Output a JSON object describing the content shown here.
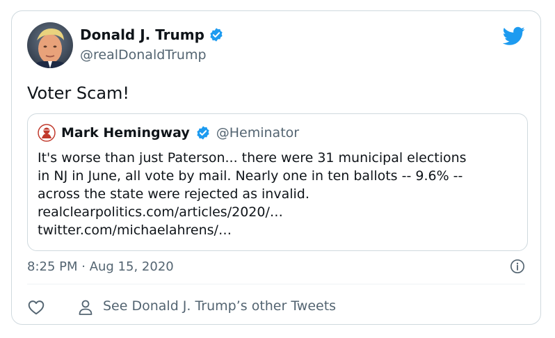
{
  "author": {
    "name": "Donald J. Trump",
    "handle": "@realDonaldTrump"
  },
  "tweet": {
    "text": "Voter Scam!",
    "timestamp": "8:25 PM · Aug 15, 2020"
  },
  "quoted": {
    "name": "Mark Hemingway",
    "handle": "@Heminator",
    "lines": [
      "It's worse than just Paterson... there were 31 municipal elections",
      "in NJ in June, all vote by mail. Nearly one in ten ballots -- 9.6% --",
      "across the state were rejected as invalid.",
      "realclearpolitics.com/articles/2020/…",
      "twitter.com/michaelahrens/…"
    ]
  },
  "footer": {
    "other_tweets": "See Donald J. Trump’s other Tweets"
  },
  "icons": {
    "brand": "twitter-bird-icon",
    "verified": "verified-badge-icon",
    "info": "info-icon",
    "like": "heart-icon",
    "profile": "person-icon"
  },
  "colors": {
    "brand_blue": "#1d9bf0",
    "secondary_text": "#536471",
    "border": "#cfd9de"
  }
}
